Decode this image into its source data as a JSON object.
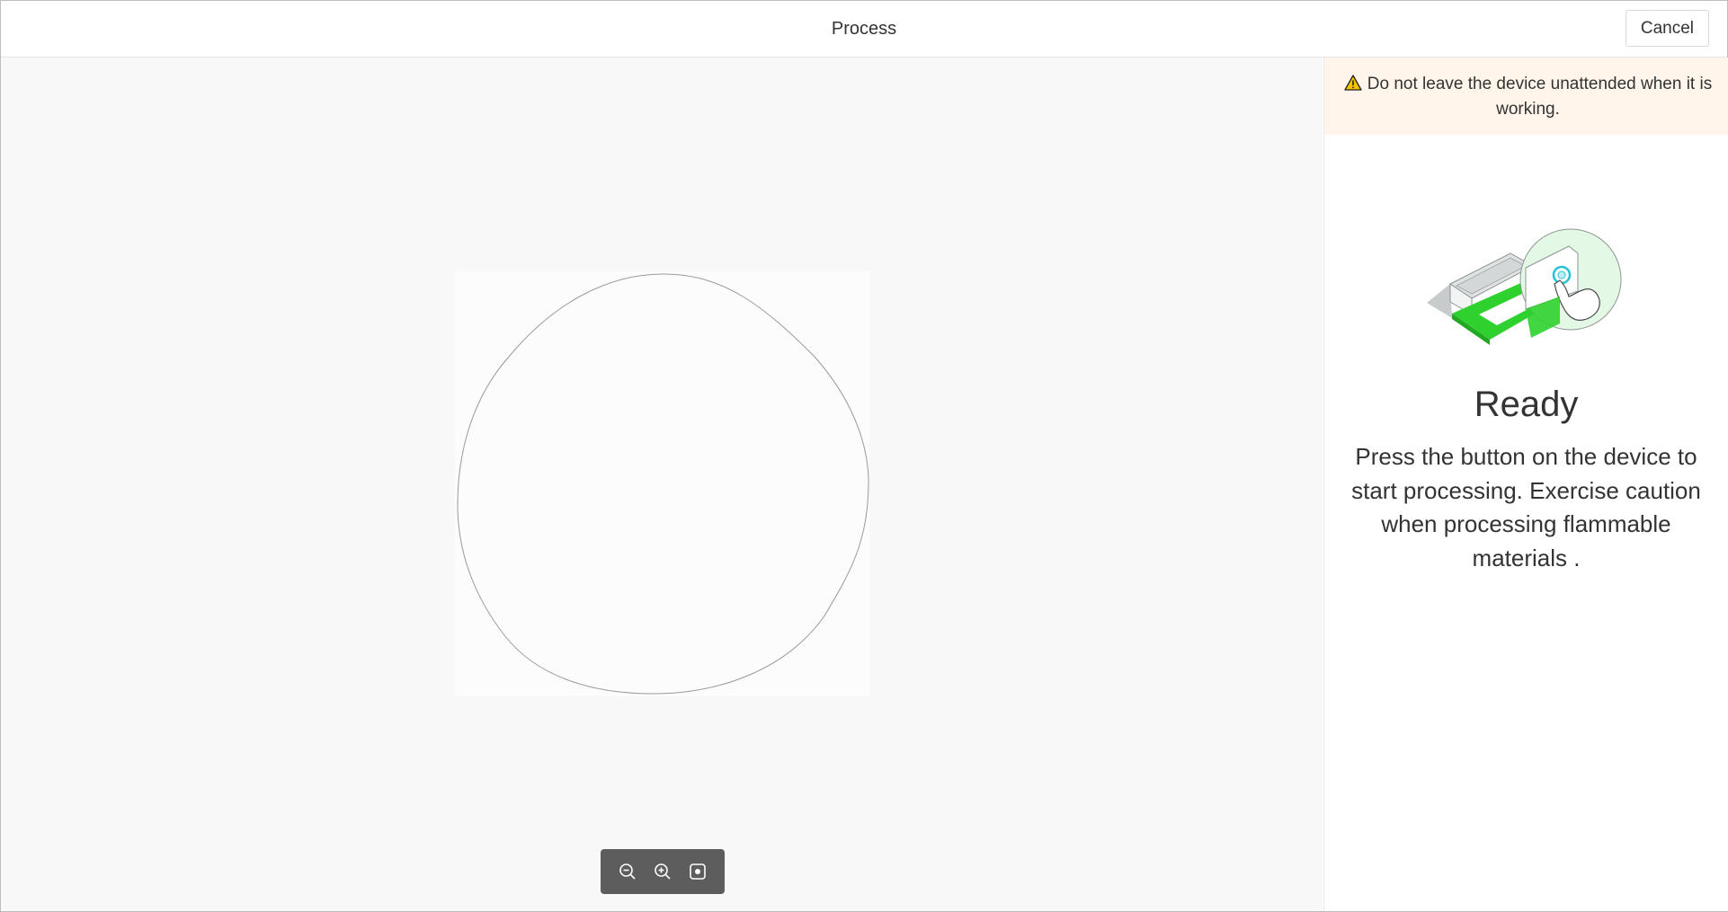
{
  "header": {
    "title": "Process",
    "cancel_label": "Cancel"
  },
  "canvas": {
    "toolbar": {
      "zoom_out_icon": "zoom-out-icon",
      "zoom_in_icon": "zoom-in-icon",
      "fit_icon": "fit-to-screen-icon"
    }
  },
  "panel": {
    "warning_text": "Do not leave the device unattended when it is working.",
    "warning_color": "#fff5ea",
    "status_title": "Ready",
    "status_description": "Press the button on the device to start processing. Exercise caution when processing flammable materials ."
  },
  "colors": {
    "accent_green": "#2fd12f",
    "canvas_bg": "#f8f8f8"
  }
}
